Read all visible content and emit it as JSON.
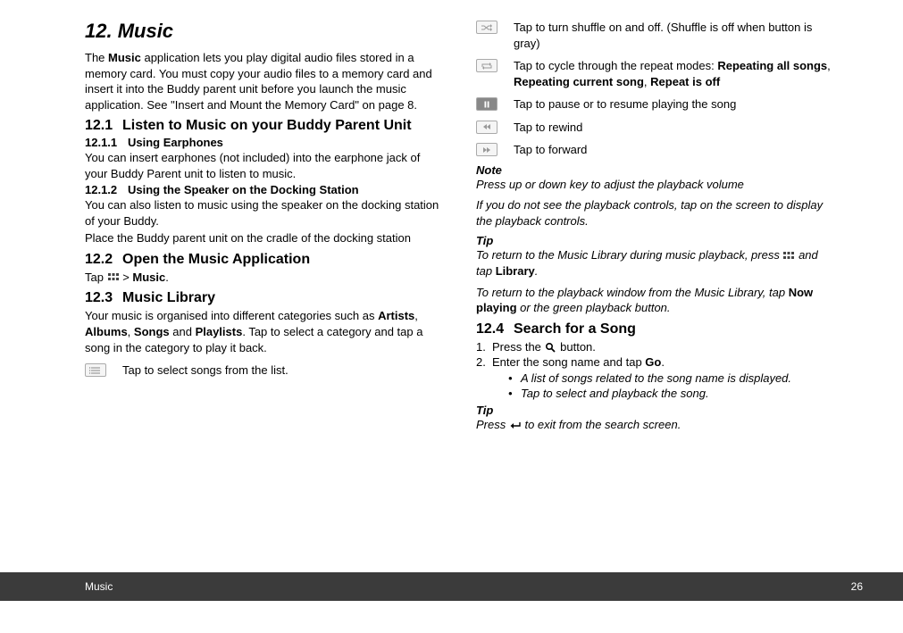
{
  "chapter_title": "12. Music",
  "intro": {
    "pre": "The ",
    "bold": "Music",
    "post": " application lets you play digital audio files stored in a memory card. You must copy your audio files to a memory card and insert it into the Buddy parent unit before you launch the music application. See \"Insert and Mount the Memory Card\" on page 8."
  },
  "s12_1": {
    "num": "12.1",
    "title": "Listen to Music on your Buddy Parent Unit"
  },
  "s12_1_1": {
    "num": "12.1.1",
    "title": "Using Earphones",
    "body": "You can insert earphones (not included) into the earphone jack of your Buddy Parent unit to listen to music."
  },
  "s12_1_2": {
    "num": "12.1.2",
    "title": "Using the Speaker on the Docking Station",
    "body1": "You can also listen to music using the speaker on the docking station of your Buddy.",
    "body2": "Place the Buddy parent unit on the cradle of the docking station"
  },
  "s12_2": {
    "num": "12.2",
    "title": "Open the Music Application",
    "tap_pre": "Tap ",
    "tap_mid": " > ",
    "tap_bold": "Music",
    "tap_post": "."
  },
  "s12_3": {
    "num": "12.3",
    "title": "Music Library",
    "body_pre": "Your music is organised into different categories such as ",
    "b1": "Artists",
    "c1": ", ",
    "b2": "Albums",
    "c2": ", ",
    "b3": "Songs",
    "c3": " and ",
    "b4": "Playlists",
    "body_post": ". Tap to select a category and tap a song in the category to play it back.",
    "list_desc": "Tap to select songs from the list."
  },
  "controls": {
    "shuffle": "Tap to turn shuffle on and off. (Shuffle is off when button is gray)",
    "repeat_pre": "Tap to cycle through the repeat modes: ",
    "repeat_b1": "Repeating all songs",
    "repeat_c1": ", ",
    "repeat_b2": "Repeating current song",
    "repeat_c2": ", ",
    "repeat_b3": "Repeat is off",
    "pause": "Tap to pause or to resume playing the song",
    "rewind": "Tap to rewind",
    "forward": "Tap to forward"
  },
  "note": {
    "heading": "Note",
    "l1": "Press up or down key to adjust the playback volume",
    "l2": "If you do not see the playback controls, tap on the screen to display the playback controls."
  },
  "tip1": {
    "heading": "Tip",
    "l1_pre": "To return to the Music Library during music playback, press ",
    "l1_post": " and tap ",
    "l1_bold": "Library",
    "l1_end": ".",
    "l2_pre": "To return to the playback window from the Music Library, tap ",
    "l2_bold": "Now playing",
    "l2_post": " or the green playback button."
  },
  "s12_4": {
    "num": "12.4",
    "title": "Search for a Song",
    "step1_pre": "Press the ",
    "step1_post": " button.",
    "step2_pre": "Enter the song name and tap ",
    "step2_bold": "Go",
    "step2_post": ".",
    "sub1": "A list of songs related to the song name is displayed.",
    "sub2": "Tap to select and playback the song."
  },
  "tip2": {
    "heading": "Tip",
    "pre": "Press ",
    "post": " to exit from the search screen."
  },
  "footer": {
    "section": "Music",
    "page": "26"
  }
}
